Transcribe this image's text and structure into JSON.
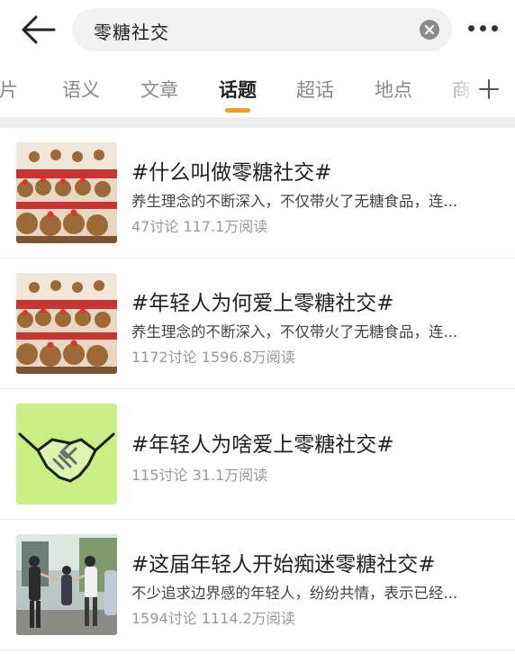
{
  "search": {
    "query": "零糖社交"
  },
  "tabs": [
    {
      "label": "图片"
    },
    {
      "label": "语义"
    },
    {
      "label": "文章"
    },
    {
      "label": "话题"
    },
    {
      "label": "超话"
    },
    {
      "label": "地点"
    },
    {
      "label": "商"
    }
  ],
  "active_tab": "话题",
  "colors": {
    "accent": "#ff9a1f",
    "handshake_bg": "#c9ee84"
  },
  "topics": [
    {
      "title": "#什么叫做零糖社交#",
      "desc": "养生理念的不断深入，不仅带火了无糖食品，连...",
      "stats": "47讨论 117.1万阅读",
      "image": "capybara-plush-display"
    },
    {
      "title": "#年轻人为何爱上零糖社交#",
      "desc": "养生理念的不断深入，不仅带火了无糖食品，连...",
      "stats": "1172讨论 1596.8万阅读",
      "image": "capybara-plush-display"
    },
    {
      "title": "#年轻人为啥爱上零糖社交#",
      "desc": "",
      "stats": "115讨论 31.1万阅读",
      "image": "handshake-icon"
    },
    {
      "title": "#这届年轻人开始痴迷零糖社交#",
      "desc": "不少追求边界感的年轻人，纷纷共情，表示已经...",
      "stats": "1594讨论 1114.2万阅读",
      "image": "people-greeting-photo"
    }
  ]
}
